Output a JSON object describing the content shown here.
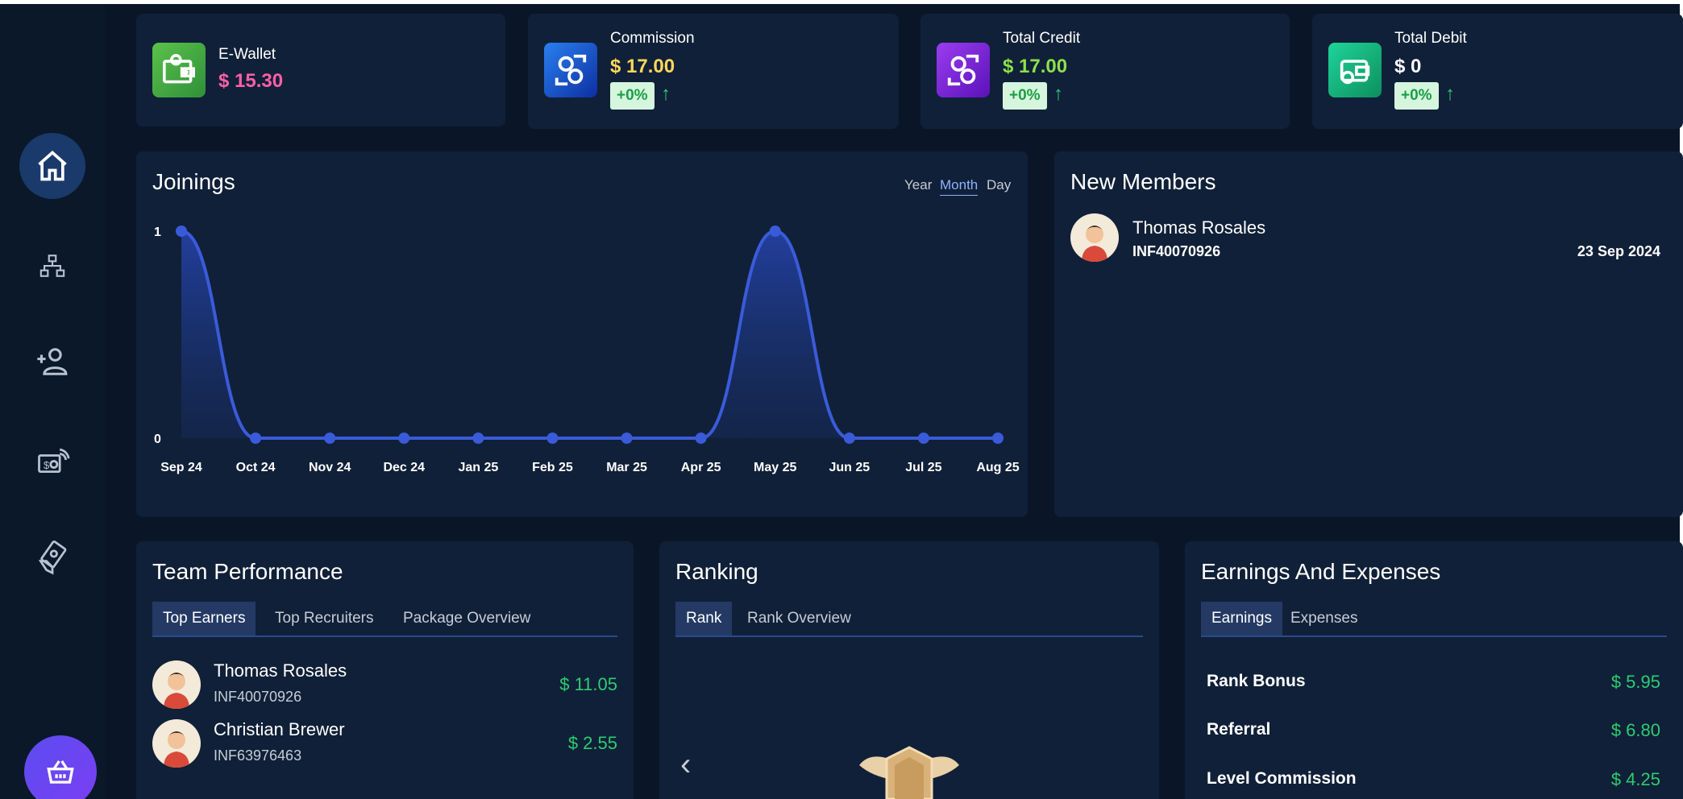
{
  "kpis": [
    {
      "title": "E-Wallet",
      "value": "$ 15.30",
      "value_color": "#ff5fa8",
      "icon": "wallet-icon",
      "icon_bg": "#3aa54a"
    },
    {
      "title": "Commission",
      "value": "$ 17.00",
      "value_color": "#ffd75a",
      "badge": "+0%",
      "icon": "commission-icon",
      "icon_bg": "#1a5fd6"
    },
    {
      "title": "Total Credit",
      "value": "$ 17.00",
      "value_color": "#8de04a",
      "badge": "+0%",
      "icon": "credit-icon",
      "icon_bg": "#7a24d8"
    },
    {
      "title": "Total Debit",
      "value": "$ 0",
      "value_color": "#ffffff",
      "badge": "+0%",
      "icon": "debit-icon",
      "icon_bg": "#16b07a"
    }
  ],
  "joinings": {
    "title": "Joinings",
    "ranges": [
      "Year",
      "Month",
      "Day"
    ],
    "active_range": "Month"
  },
  "chart_data": {
    "type": "area",
    "categories": [
      "Sep 24",
      "Oct 24",
      "Nov 24",
      "Dec 24",
      "Jan 25",
      "Feb 25",
      "Mar 25",
      "Apr 25",
      "May 25",
      "Jun 25",
      "Jul 25",
      "Aug 25"
    ],
    "values": [
      1,
      0,
      0,
      0,
      0,
      0,
      0,
      0,
      1,
      0,
      0,
      0
    ],
    "yticks": [
      "1",
      "0"
    ],
    "ylim": [
      0,
      1
    ],
    "color": "#3a5bd9"
  },
  "new_members": {
    "title": "New Members",
    "items": [
      {
        "name": "Thomas Rosales",
        "id": "INF40070926",
        "date": "23 Sep 2024"
      }
    ]
  },
  "team_performance": {
    "title": "Team Performance",
    "tabs": [
      "Top Earners",
      "Top Recruiters",
      "Package Overview"
    ],
    "rows": [
      {
        "name": "Thomas Rosales",
        "id": "INF40070926",
        "amount": "$ 11.05"
      },
      {
        "name": "Christian Brewer",
        "id": "INF63976463",
        "amount": "$ 2.55"
      }
    ]
  },
  "ranking": {
    "title": "Ranking",
    "tabs": [
      "Rank",
      "Rank Overview"
    ]
  },
  "earnings": {
    "title": "Earnings And Expenses",
    "tabs": [
      "Earnings",
      "Expenses"
    ],
    "rows": [
      {
        "label": "Rank Bonus",
        "amount": "$ 5.95"
      },
      {
        "label": "Referral",
        "amount": "$ 6.80"
      },
      {
        "label": "Level Commission",
        "amount": "$ 4.25"
      }
    ]
  },
  "sidebar": {
    "items": [
      "home-icon",
      "tree-icon",
      "add-user-icon",
      "payout-icon",
      "money-hand-icon",
      "basket-icon"
    ]
  }
}
